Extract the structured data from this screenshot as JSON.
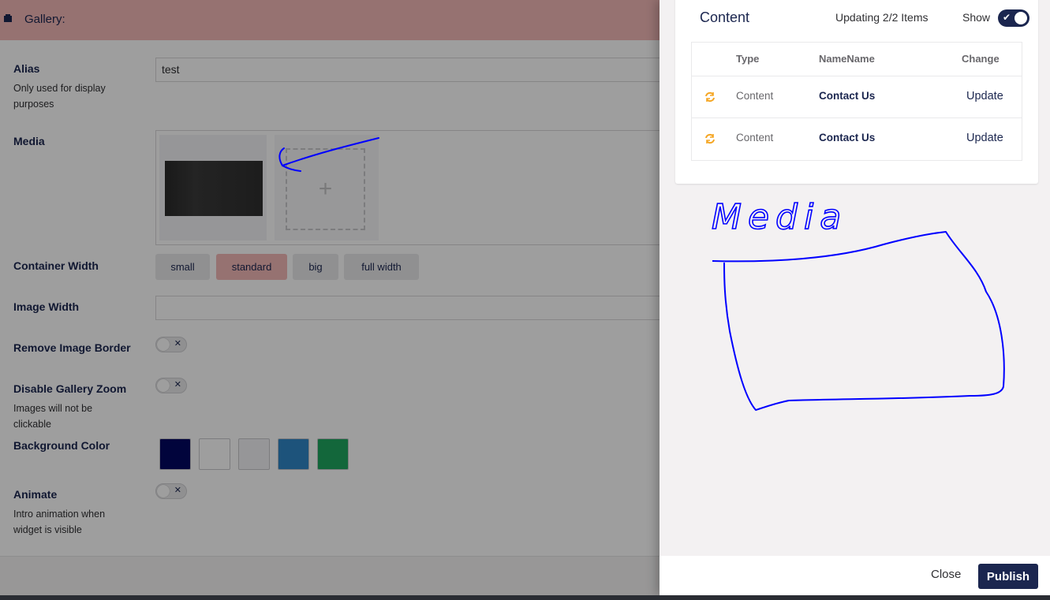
{
  "editor": {
    "header_title": "Gallery:",
    "alias": {
      "label": "Alias",
      "description": "Only used for display purposes",
      "value": "test"
    },
    "media": {
      "label": "Media"
    },
    "container_width": {
      "label": "Container Width",
      "options": [
        "small",
        "standard",
        "big",
        "full width"
      ],
      "selected": "standard"
    },
    "image_width": {
      "label": "Image Width",
      "value": ""
    },
    "remove_image_border": {
      "label": "Remove Image Border",
      "on": false
    },
    "disable_gallery_zoom": {
      "label": "Disable Gallery Zoom",
      "description": "Images will not be clickable",
      "on": false
    },
    "background_color": {
      "label": "Background Color",
      "colors": [
        "#020862",
        "#ffffff",
        "#f3f3f5",
        "#2f86c7",
        "#1fa75f"
      ]
    },
    "animate": {
      "label": "Animate",
      "description": "Intro animation when widget is visible",
      "on": false
    },
    "toggle_off_glyph": "✕",
    "add_glyph": "+"
  },
  "panel": {
    "title": "Content",
    "status": "Updating 2/2 Items",
    "show_label": "Show",
    "show_on": true,
    "check_glyph": "✔",
    "columns": [
      "Type",
      "NameName",
      "Change"
    ],
    "rows": [
      {
        "icon": "sync-icon",
        "type": "Content",
        "name": "Contact Us",
        "change": "Update"
      },
      {
        "icon": "sync-icon",
        "type": "Content",
        "name": "Contact Us",
        "change": "Update"
      }
    ],
    "close_label": "Close",
    "publish_label": "Publish"
  },
  "annotations": {
    "handwritten_text": "Media"
  },
  "colors": {
    "brand_navy": "#1b264f",
    "accent_pink": "#f3b9b7",
    "sync_orange": "#f5a623",
    "ink_blue": "#0000ff"
  }
}
